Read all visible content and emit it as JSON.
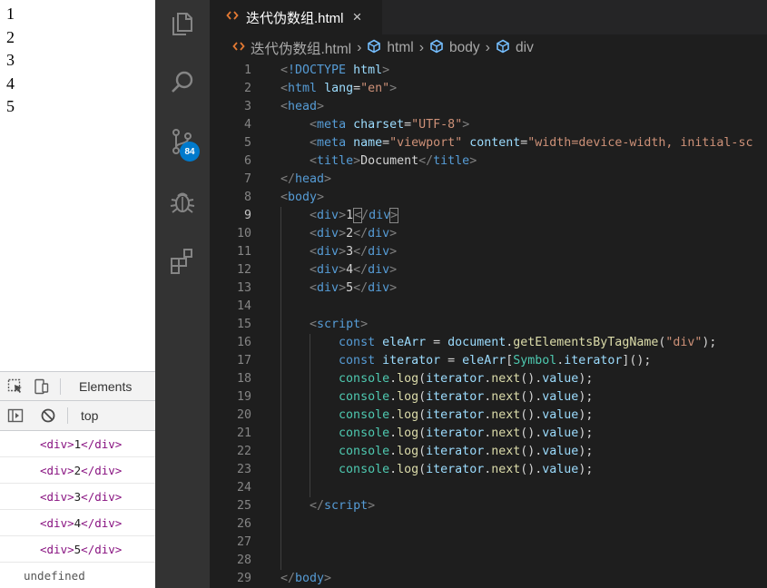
{
  "browser_page": {
    "lines": [
      "1",
      "2",
      "3",
      "4",
      "5"
    ]
  },
  "devtools": {
    "tabs": {
      "elements_label": "Elements"
    },
    "toolbar": {
      "context_label": "top"
    },
    "console_lines": [
      {
        "open": "<div>",
        "text": "1",
        "close": "</div>"
      },
      {
        "open": "<div>",
        "text": "2",
        "close": "</div>"
      },
      {
        "open": "<div>",
        "text": "3",
        "close": "</div>"
      },
      {
        "open": "<div>",
        "text": "4",
        "close": "</div>"
      },
      {
        "open": "<div>",
        "text": "5",
        "close": "</div>"
      }
    ],
    "undefined_label": "undefined"
  },
  "vscode": {
    "activity_bar": {
      "items": [
        "explorer-icon",
        "search-icon",
        "source-control-icon",
        "debug-icon",
        "extensions-icon"
      ],
      "scm_badge": "84"
    },
    "tab": {
      "label": "迭代伪数组.html",
      "close": "×"
    },
    "breadcrumb": {
      "file": "迭代伪数组.html",
      "items": [
        "html",
        "body",
        "div"
      ]
    },
    "colors": {
      "accent": "#007acc",
      "tag": "#569cd6",
      "attr": "#9cdcfe",
      "string": "#ce9178",
      "function": "#dcdcaa",
      "type": "#4ec9b0"
    },
    "active_line": 9,
    "lines": [
      [
        [
          "punct",
          "<"
        ],
        [
          "tag",
          "!DOCTYPE"
        ],
        [
          "text",
          " "
        ],
        [
          "attr",
          "html"
        ],
        [
          "punct",
          ">"
        ]
      ],
      [
        [
          "punct",
          "<"
        ],
        [
          "tag",
          "html"
        ],
        [
          "text",
          " "
        ],
        [
          "attr",
          "lang"
        ],
        [
          "text",
          "="
        ],
        [
          "str",
          "\"en\""
        ],
        [
          "punct",
          ">"
        ]
      ],
      [
        [
          "punct",
          "<"
        ],
        [
          "tag",
          "head"
        ],
        [
          "punct",
          ">"
        ]
      ],
      [
        [
          "text",
          "    "
        ],
        [
          "punct",
          "<"
        ],
        [
          "tag",
          "meta"
        ],
        [
          "text",
          " "
        ],
        [
          "attr",
          "charset"
        ],
        [
          "text",
          "="
        ],
        [
          "str",
          "\"UTF-8\""
        ],
        [
          "punct",
          ">"
        ]
      ],
      [
        [
          "text",
          "    "
        ],
        [
          "punct",
          "<"
        ],
        [
          "tag",
          "meta"
        ],
        [
          "text",
          " "
        ],
        [
          "attr",
          "name"
        ],
        [
          "text",
          "="
        ],
        [
          "str",
          "\"viewport\""
        ],
        [
          "text",
          " "
        ],
        [
          "attr",
          "content"
        ],
        [
          "text",
          "="
        ],
        [
          "str",
          "\"width=device-width, initial-sc"
        ]
      ],
      [
        [
          "text",
          "    "
        ],
        [
          "punct",
          "<"
        ],
        [
          "tag",
          "title"
        ],
        [
          "punct",
          ">"
        ],
        [
          "text",
          "Document"
        ],
        [
          "punct",
          "</"
        ],
        [
          "tag",
          "title"
        ],
        [
          "punct",
          ">"
        ]
      ],
      [
        [
          "punct",
          "</"
        ],
        [
          "tag",
          "head"
        ],
        [
          "punct",
          ">"
        ]
      ],
      [
        [
          "punct",
          "<"
        ],
        [
          "tag",
          "body"
        ],
        [
          "punct",
          ">"
        ]
      ],
      [
        [
          "text",
          "    "
        ],
        [
          "punct",
          "<"
        ],
        [
          "tag",
          "div"
        ],
        [
          "punct",
          ">"
        ],
        [
          "text",
          "1"
        ],
        [
          "cursor",
          ""
        ],
        [
          "bpunct",
          "<"
        ],
        [
          "punct",
          "/"
        ],
        [
          "tag",
          "div"
        ],
        [
          "bpunct",
          ">"
        ]
      ],
      [
        [
          "text",
          "    "
        ],
        [
          "punct",
          "<"
        ],
        [
          "tag",
          "div"
        ],
        [
          "punct",
          ">"
        ],
        [
          "text",
          "2"
        ],
        [
          "punct",
          "</"
        ],
        [
          "tag",
          "div"
        ],
        [
          "punct",
          ">"
        ]
      ],
      [
        [
          "text",
          "    "
        ],
        [
          "punct",
          "<"
        ],
        [
          "tag",
          "div"
        ],
        [
          "punct",
          ">"
        ],
        [
          "text",
          "3"
        ],
        [
          "punct",
          "</"
        ],
        [
          "tag",
          "div"
        ],
        [
          "punct",
          ">"
        ]
      ],
      [
        [
          "text",
          "    "
        ],
        [
          "punct",
          "<"
        ],
        [
          "tag",
          "div"
        ],
        [
          "punct",
          ">"
        ],
        [
          "text",
          "4"
        ],
        [
          "punct",
          "</"
        ],
        [
          "tag",
          "div"
        ],
        [
          "punct",
          ">"
        ]
      ],
      [
        [
          "text",
          "    "
        ],
        [
          "punct",
          "<"
        ],
        [
          "tag",
          "div"
        ],
        [
          "punct",
          ">"
        ],
        [
          "text",
          "5"
        ],
        [
          "punct",
          "</"
        ],
        [
          "tag",
          "div"
        ],
        [
          "punct",
          ">"
        ]
      ],
      [],
      [
        [
          "text",
          "    "
        ],
        [
          "punct",
          "<"
        ],
        [
          "tag",
          "script"
        ],
        [
          "punct",
          ">"
        ]
      ],
      [
        [
          "text",
          "        "
        ],
        [
          "kw",
          "const"
        ],
        [
          "text",
          " "
        ],
        [
          "var",
          "eleArr"
        ],
        [
          "text",
          " = "
        ],
        [
          "var",
          "document"
        ],
        [
          "text",
          "."
        ],
        [
          "fn",
          "getElementsByTagName"
        ],
        [
          "text",
          "("
        ],
        [
          "str",
          "\"div\""
        ],
        [
          "text",
          ");"
        ]
      ],
      [
        [
          "text",
          "        "
        ],
        [
          "kw",
          "const"
        ],
        [
          "text",
          " "
        ],
        [
          "var",
          "iterator"
        ],
        [
          "text",
          " = "
        ],
        [
          "var",
          "eleArr"
        ],
        [
          "text",
          "["
        ],
        [
          "type",
          "Symbol"
        ],
        [
          "text",
          "."
        ],
        [
          "var",
          "iterator"
        ],
        [
          "text",
          "]();"
        ]
      ],
      [
        [
          "text",
          "        "
        ],
        [
          "type",
          "console"
        ],
        [
          "text",
          "."
        ],
        [
          "fn",
          "log"
        ],
        [
          "text",
          "("
        ],
        [
          "var",
          "iterator"
        ],
        [
          "text",
          "."
        ],
        [
          "fn",
          "next"
        ],
        [
          "text",
          "()."
        ],
        [
          "var",
          "value"
        ],
        [
          "text",
          ");"
        ]
      ],
      [
        [
          "text",
          "        "
        ],
        [
          "type",
          "console"
        ],
        [
          "text",
          "."
        ],
        [
          "fn",
          "log"
        ],
        [
          "text",
          "("
        ],
        [
          "var",
          "iterator"
        ],
        [
          "text",
          "."
        ],
        [
          "fn",
          "next"
        ],
        [
          "text",
          "()."
        ],
        [
          "var",
          "value"
        ],
        [
          "text",
          ");"
        ]
      ],
      [
        [
          "text",
          "        "
        ],
        [
          "type",
          "console"
        ],
        [
          "text",
          "."
        ],
        [
          "fn",
          "log"
        ],
        [
          "text",
          "("
        ],
        [
          "var",
          "iterator"
        ],
        [
          "text",
          "."
        ],
        [
          "fn",
          "next"
        ],
        [
          "text",
          "()."
        ],
        [
          "var",
          "value"
        ],
        [
          "text",
          ");"
        ]
      ],
      [
        [
          "text",
          "        "
        ],
        [
          "type",
          "console"
        ],
        [
          "text",
          "."
        ],
        [
          "fn",
          "log"
        ],
        [
          "text",
          "("
        ],
        [
          "var",
          "iterator"
        ],
        [
          "text",
          "."
        ],
        [
          "fn",
          "next"
        ],
        [
          "text",
          "()."
        ],
        [
          "var",
          "value"
        ],
        [
          "text",
          ");"
        ]
      ],
      [
        [
          "text",
          "        "
        ],
        [
          "type",
          "console"
        ],
        [
          "text",
          "."
        ],
        [
          "fn",
          "log"
        ],
        [
          "text",
          "("
        ],
        [
          "var",
          "iterator"
        ],
        [
          "text",
          "."
        ],
        [
          "fn",
          "next"
        ],
        [
          "text",
          "()."
        ],
        [
          "var",
          "value"
        ],
        [
          "text",
          ");"
        ]
      ],
      [
        [
          "text",
          "        "
        ],
        [
          "type",
          "console"
        ],
        [
          "text",
          "."
        ],
        [
          "fn",
          "log"
        ],
        [
          "text",
          "("
        ],
        [
          "var",
          "iterator"
        ],
        [
          "text",
          "."
        ],
        [
          "fn",
          "next"
        ],
        [
          "text",
          "()."
        ],
        [
          "var",
          "value"
        ],
        [
          "text",
          ");"
        ]
      ],
      [],
      [
        [
          "text",
          "    "
        ],
        [
          "punct",
          "</"
        ],
        [
          "tag",
          "script"
        ],
        [
          "punct",
          ">"
        ]
      ],
      [],
      [],
      [],
      [
        [
          "punct",
          "</"
        ],
        [
          "tag",
          "body"
        ],
        [
          "punct",
          ">"
        ]
      ]
    ]
  }
}
